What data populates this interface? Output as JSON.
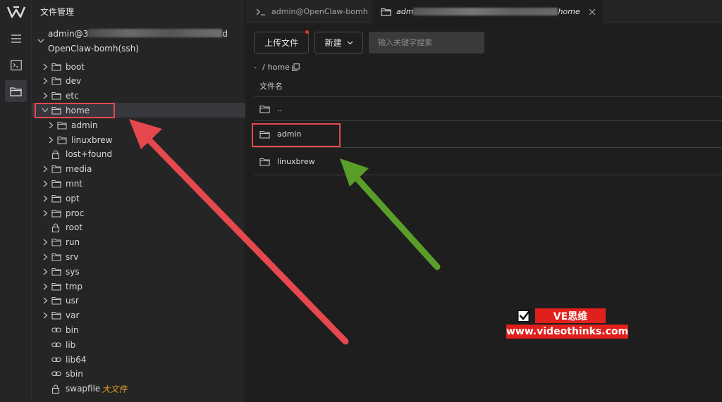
{
  "sidebar": {
    "title": "文件管理",
    "connection_user": "admin@3",
    "connection_suffix": "d",
    "connection_name": "OpenClaw-bomh(ssh)",
    "tree": [
      {
        "label": "boot",
        "type": "folder"
      },
      {
        "label": "dev",
        "type": "folder"
      },
      {
        "label": "etc",
        "type": "folder"
      },
      {
        "label": "home",
        "type": "folder",
        "expanded": true,
        "selected": true
      },
      {
        "label": "admin",
        "type": "folder",
        "child": true
      },
      {
        "label": "linuxbrew",
        "type": "folder",
        "child": true
      },
      {
        "label": "lost+found",
        "type": "lock"
      },
      {
        "label": "media",
        "type": "folder"
      },
      {
        "label": "mnt",
        "type": "folder"
      },
      {
        "label": "opt",
        "type": "folder"
      },
      {
        "label": "proc",
        "type": "folder"
      },
      {
        "label": "root",
        "type": "lock"
      },
      {
        "label": "run",
        "type": "folder"
      },
      {
        "label": "srv",
        "type": "folder"
      },
      {
        "label": "sys",
        "type": "folder"
      },
      {
        "label": "tmp",
        "type": "folder"
      },
      {
        "label": "usr",
        "type": "folder"
      },
      {
        "label": "var",
        "type": "folder"
      },
      {
        "label": "bin",
        "type": "link"
      },
      {
        "label": "lib",
        "type": "link"
      },
      {
        "label": "lib64",
        "type": "link"
      },
      {
        "label": "sbin",
        "type": "link"
      },
      {
        "label": "swapfile",
        "type": "lock",
        "tag": "大文件"
      }
    ]
  },
  "tabs": [
    {
      "label": "admin@OpenClaw-bomh",
      "icon": "terminal-icon"
    },
    {
      "label_prefix": "adm",
      "label_suffix": "home",
      "icon": "folder-icon",
      "active": true
    }
  ],
  "toolbar": {
    "upload_label": "上传文件",
    "new_label": "新建",
    "search_placeholder": "输入关键字搜索"
  },
  "breadcrumb": {
    "root": "-",
    "sep": "/",
    "current": "home"
  },
  "file_list": {
    "column_name": "文件名",
    "rows": [
      "..",
      "admin",
      "linuxbrew"
    ]
  },
  "watermark": {
    "title": "VE思维",
    "url": "www.videothinks.com"
  },
  "colors": {
    "highlight_red": "#e5484d",
    "arrow_red": "#e5484d",
    "arrow_green": "#5a9e2a",
    "watermark_red": "#e0201c",
    "tag_orange": "#e8a020"
  }
}
